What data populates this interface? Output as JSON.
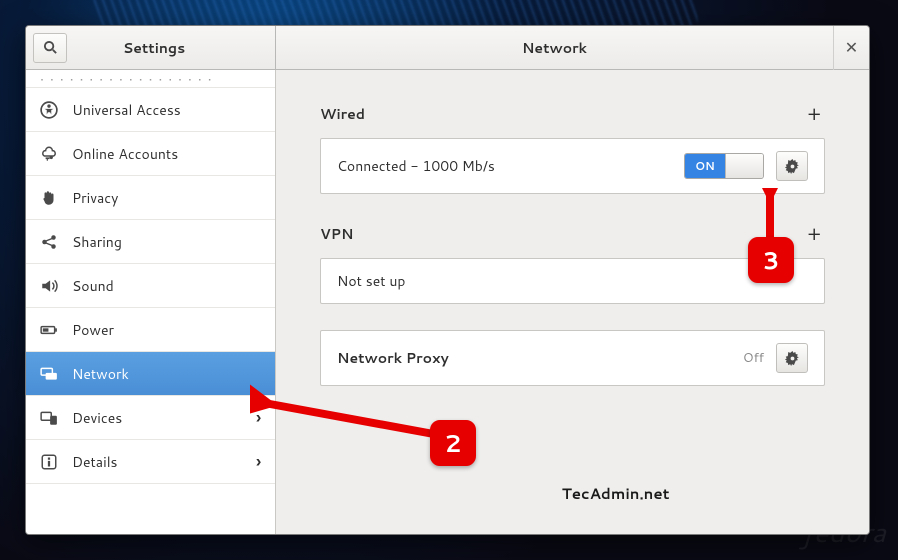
{
  "titlebar": {
    "settings_title": "Settings",
    "panel_title": "Network"
  },
  "sidebar": {
    "items": [
      {
        "label": "Universal Access"
      },
      {
        "label": "Online Accounts"
      },
      {
        "label": "Privacy"
      },
      {
        "label": "Sharing"
      },
      {
        "label": "Sound"
      },
      {
        "label": "Power"
      },
      {
        "label": "Network"
      },
      {
        "label": "Devices"
      },
      {
        "label": "Details"
      }
    ]
  },
  "network": {
    "wired_header": "Wired",
    "wired_status": "Connected - 1000 Mb/s",
    "wired_toggle": "ON",
    "vpn_header": "VPN",
    "vpn_status": "Not set up",
    "proxy_label": "Network Proxy",
    "proxy_status": "Off"
  },
  "annotations": {
    "badge2": "2",
    "badge3": "3"
  },
  "watermark": "TecAdmin.net",
  "os_watermark": "fedora"
}
